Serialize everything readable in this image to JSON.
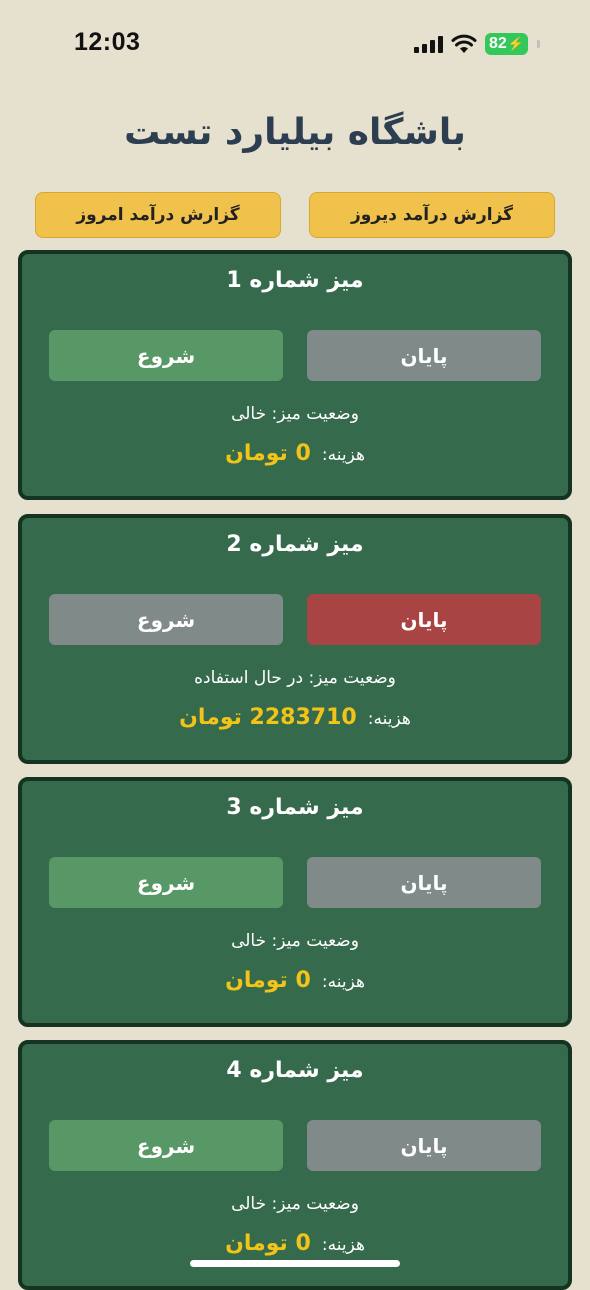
{
  "status_bar": {
    "time": "12:03",
    "battery": "82"
  },
  "title": "باشگاه بیلیارد تست",
  "reports": {
    "yesterday_label": "گزارش درآمد دیروز",
    "today_label": "گزارش درآمد امروز"
  },
  "tables": [
    {
      "name": "میز شماره 1",
      "end_label": "پایان",
      "start_label": "شروع",
      "status": "وضعیت میز: خالی",
      "cost_label": "هزینه:",
      "cost": "0 تومان"
    },
    {
      "name": "میز شماره 2",
      "end_label": "پایان",
      "start_label": "شروع",
      "status": "وضعیت میز: در حال استفاده",
      "cost_label": "هزینه:",
      "cost": "2283710 تومان"
    },
    {
      "name": "میز شماره 3",
      "end_label": "پایان",
      "start_label": "شروع",
      "status": "وضعیت میز: خالی",
      "cost_label": "هزینه:",
      "cost": "0 تومان"
    },
    {
      "name": "میز شماره 4",
      "end_label": "پایان",
      "start_label": "شروع",
      "status": "وضعیت میز: خالی",
      "cost_label": "هزینه:",
      "cost": "0 تومان"
    }
  ],
  "colors": {
    "background": "#e6e0cf",
    "card": "#356a4d",
    "start_active": "#579866",
    "end_active": "#a94444",
    "disabled": "#7f8a89",
    "cost": "#f3c418",
    "report_button": "#f0c14b"
  }
}
